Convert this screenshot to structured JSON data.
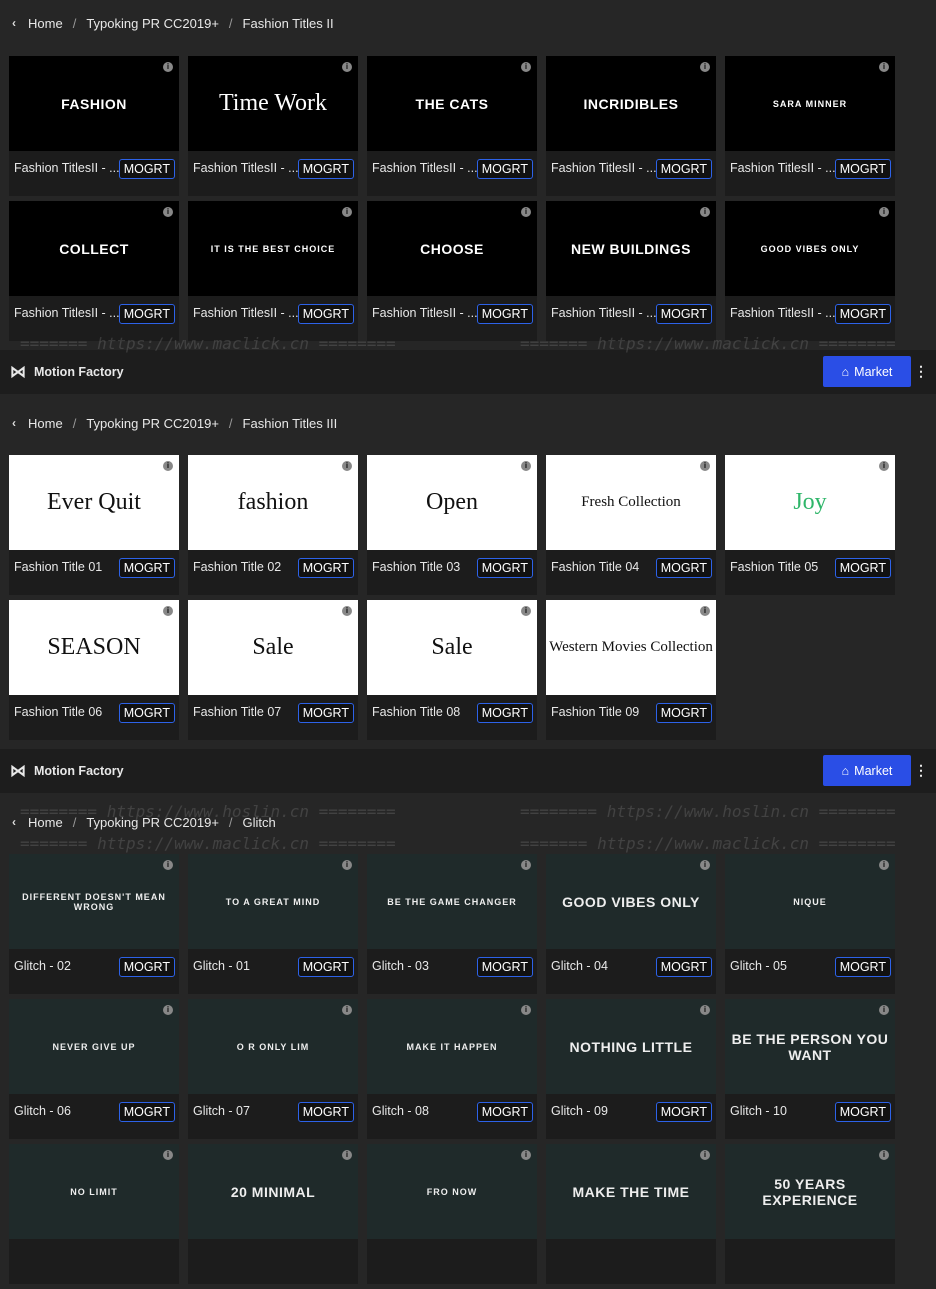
{
  "panels": [
    {
      "breadcrumb": [
        "Home",
        "Typoking PR CC2019+",
        "Fashion Titles II"
      ],
      "theme": "dark",
      "cards": [
        {
          "name": "Fashion TitlesII - ...",
          "thumb": "FASHION",
          "style": "tt"
        },
        {
          "name": "Fashion TitlesII - ...",
          "thumb": "Time Work",
          "style": "serif"
        },
        {
          "name": "Fashion TitlesII - ...",
          "thumb": "THE CATS",
          "style": "tt"
        },
        {
          "name": "Fashion TitlesII - ...",
          "thumb": "INCRIDIBLES",
          "style": "tt"
        },
        {
          "name": "Fashion TitlesII - ...",
          "thumb": "SARA MINNER",
          "style": "small"
        },
        {
          "name": "Fashion TitlesII - ...",
          "thumb": "COLLECT",
          "style": "tt"
        },
        {
          "name": "Fashion TitlesII - ...",
          "thumb": "IT IS THE BEST CHOICE",
          "style": "small"
        },
        {
          "name": "Fashion TitlesII - ...",
          "thumb": "CHOOSE",
          "style": "tt"
        },
        {
          "name": "Fashion TitlesII - ...",
          "thumb": "NEW BUILDINGS",
          "style": "tt"
        },
        {
          "name": "Fashion TitlesII - ...",
          "thumb": "GOOD VIBES ONLY",
          "style": "small"
        }
      ]
    },
    {
      "breadcrumb": [
        "Home",
        "Typoking PR CC2019+",
        "Fashion Titles III"
      ],
      "theme": "light",
      "cards": [
        {
          "name": "Fashion Title 01",
          "thumb": "Ever Quit",
          "style": "serif"
        },
        {
          "name": "Fashion Title 02",
          "thumb": "fashion",
          "style": "serif"
        },
        {
          "name": "Fashion Title 03",
          "thumb": "Open",
          "style": "serif"
        },
        {
          "name": "Fashion Title 04",
          "thumb": "Fresh Collection",
          "style": "serif"
        },
        {
          "name": "Fashion Title 05",
          "thumb": "Joy",
          "style": "serifg"
        },
        {
          "name": "Fashion Title 06",
          "thumb": "SEASON",
          "style": "serif"
        },
        {
          "name": "Fashion Title 07",
          "thumb": "Sale",
          "style": "serif"
        },
        {
          "name": "Fashion Title 08",
          "thumb": "Sale",
          "style": "serif"
        },
        {
          "name": "Fashion Title 09",
          "thumb": "Western Movies Collection",
          "style": "serif"
        }
      ]
    },
    {
      "breadcrumb": [
        "Home",
        "Typoking PR CC2019+",
        "Glitch"
      ],
      "theme": "glitch",
      "cards": [
        {
          "name": "Glitch - 02",
          "thumb": "DIFFERENT DOESN'T MEAN WRONG",
          "style": "small"
        },
        {
          "name": "Glitch - 01",
          "thumb": "TO A GREAT MIND",
          "style": "small"
        },
        {
          "name": "Glitch - 03",
          "thumb": "BE THE GAME CHANGER",
          "style": "small"
        },
        {
          "name": "Glitch - 04",
          "thumb": "GOOD VIBES ONLY",
          "style": "tt"
        },
        {
          "name": "Glitch - 05",
          "thumb": "NIQUE",
          "style": "small"
        },
        {
          "name": "Glitch - 06",
          "thumb": "NEVER GIVE UP",
          "style": "small"
        },
        {
          "name": "Glitch - 07",
          "thumb": "O R ONLY LIM",
          "style": "small"
        },
        {
          "name": "Glitch - 08",
          "thumb": "MAKE IT HAPPEN",
          "style": "small"
        },
        {
          "name": "Glitch - 09",
          "thumb": "NOTHING    LITTLE",
          "style": "tt"
        },
        {
          "name": "Glitch - 10",
          "thumb": "BE THE PERSON YOU WANT",
          "style": "tt"
        },
        {
          "name": "",
          "thumb": "NO LIMIT",
          "style": "small"
        },
        {
          "name": "",
          "thumb": "20 MINIMAL",
          "style": "tt"
        },
        {
          "name": "",
          "thumb": "FRO NOW",
          "style": "small"
        },
        {
          "name": "",
          "thumb": "MAKE THE TIME",
          "style": "tt"
        },
        {
          "name": "",
          "thumb": "50 YEARS EXPERIENCE",
          "style": "tt"
        }
      ]
    }
  ],
  "topbar": {
    "brand": "Motion Factory",
    "market_label": "Market"
  },
  "badge": "MOGRT",
  "info_glyph": "i",
  "watermarks": {
    "maclick": "======= https://www.maclick.cn ========",
    "hoslin": "======== https://www.hoslin.cn ========"
  },
  "colors": {
    "accent": "#2a4ee6",
    "badge_border": "#2d62e8"
  }
}
